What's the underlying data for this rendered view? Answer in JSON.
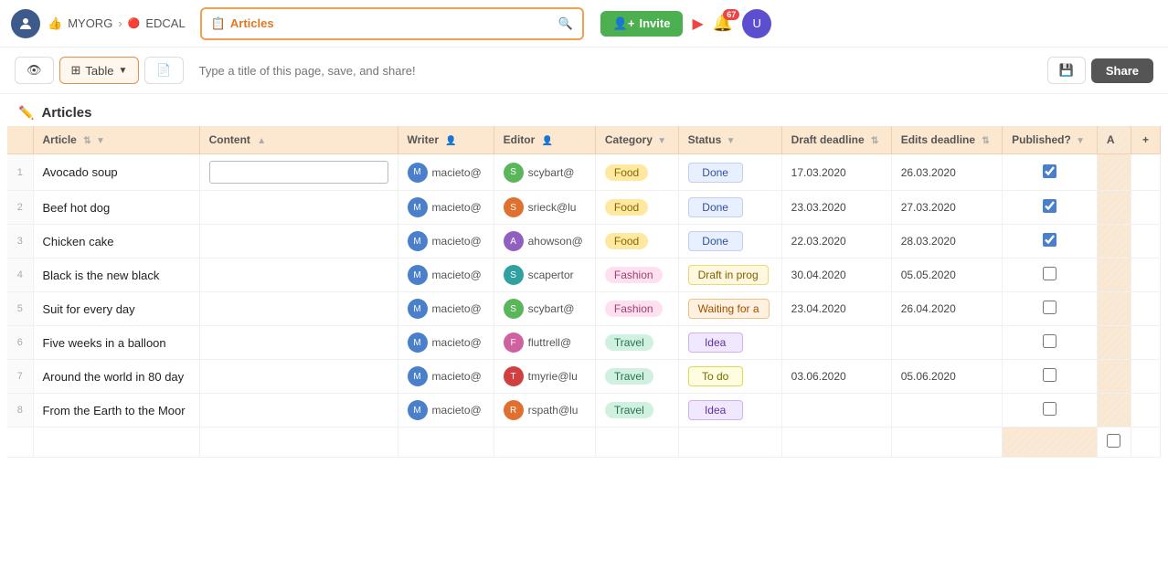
{
  "nav": {
    "org": "MYORG",
    "project": "EDCAL",
    "search_label": "Articles",
    "global_placeholder": "Type a title of this page, save, and share!",
    "invite_label": "Invite",
    "notif_count": "67"
  },
  "toolbar": {
    "view_icon": "👁",
    "table_label": "Table",
    "export_icon": "📄",
    "title_placeholder": "Type a title of this page, save, and share!",
    "save_icon": "💾",
    "share_label": "Share"
  },
  "page": {
    "title": "Articles"
  },
  "table": {
    "columns": [
      "Article",
      "Content",
      "Writer",
      "Editor",
      "Category",
      "Status",
      "Draft deadline",
      "Edits deadline",
      "Published?",
      "A"
    ],
    "rows": [
      {
        "num": 1,
        "article": "Avocado soup",
        "content": "",
        "writer": "macieto@",
        "writer_color": "av-blue",
        "editor": "scybart@",
        "editor_color": "av-green",
        "category": "Food",
        "cat_class": "cat-food",
        "status": "Done",
        "st_class": "st-done",
        "draft_deadline": "17.03.2020",
        "edits_deadline": "26.03.2020",
        "published": true
      },
      {
        "num": 2,
        "article": "Beef hot dog",
        "content": "",
        "writer": "macieto@",
        "writer_color": "av-blue",
        "editor": "srieck@lu",
        "editor_color": "av-orange",
        "category": "Food",
        "cat_class": "cat-food",
        "status": "Done",
        "st_class": "st-done",
        "draft_deadline": "23.03.2020",
        "edits_deadline": "27.03.2020",
        "published": true
      },
      {
        "num": 3,
        "article": "Chicken cake",
        "content": "",
        "writer": "macieto@",
        "writer_color": "av-blue",
        "editor": "ahowson@",
        "editor_color": "av-purple",
        "category": "Food",
        "cat_class": "cat-food",
        "status": "Done",
        "st_class": "st-done",
        "draft_deadline": "22.03.2020",
        "edits_deadline": "28.03.2020",
        "published": true
      },
      {
        "num": 4,
        "article": "Black is the new black",
        "content": "",
        "writer": "macieto@",
        "writer_color": "av-blue",
        "editor": "scapertor",
        "editor_color": "av-teal",
        "category": "Fashion",
        "cat_class": "cat-fashion",
        "status": "Draft in prog",
        "st_class": "st-draft",
        "draft_deadline": "30.04.2020",
        "edits_deadline": "05.05.2020",
        "published": false
      },
      {
        "num": 5,
        "article": "Suit for every day",
        "content": "",
        "writer": "macieto@",
        "writer_color": "av-blue",
        "editor": "scybart@",
        "editor_color": "av-green",
        "category": "Fashion",
        "cat_class": "cat-fashion",
        "status": "Waiting for a",
        "st_class": "st-waiting",
        "draft_deadline": "23.04.2020",
        "edits_deadline": "26.04.2020",
        "published": false
      },
      {
        "num": 6,
        "article": "Five weeks in a balloon",
        "content": "",
        "writer": "macieto@",
        "writer_color": "av-blue",
        "editor": "fluttrell@",
        "editor_color": "av-pink",
        "category": "Travel",
        "cat_class": "cat-travel",
        "status": "Idea",
        "st_class": "st-idea",
        "draft_deadline": "",
        "edits_deadline": "",
        "published": false
      },
      {
        "num": 7,
        "article": "Around the world in 80 day",
        "content": "",
        "writer": "macieto@",
        "writer_color": "av-blue",
        "editor": "tmyrie@lu",
        "editor_color": "av-red",
        "category": "Travel",
        "cat_class": "cat-travel",
        "status": "To do",
        "st_class": "st-todo",
        "draft_deadline": "03.06.2020",
        "edits_deadline": "05.06.2020",
        "published": false
      },
      {
        "num": 8,
        "article": "From the Earth to the Moor",
        "content": "",
        "writer": "macieto@",
        "writer_color": "av-blue",
        "editor": "rspath@lu",
        "editor_color": "av-orange",
        "category": "Travel",
        "cat_class": "cat-travel",
        "status": "Idea",
        "st_class": "st-idea",
        "draft_deadline": "",
        "edits_deadline": "",
        "published": false
      }
    ]
  }
}
